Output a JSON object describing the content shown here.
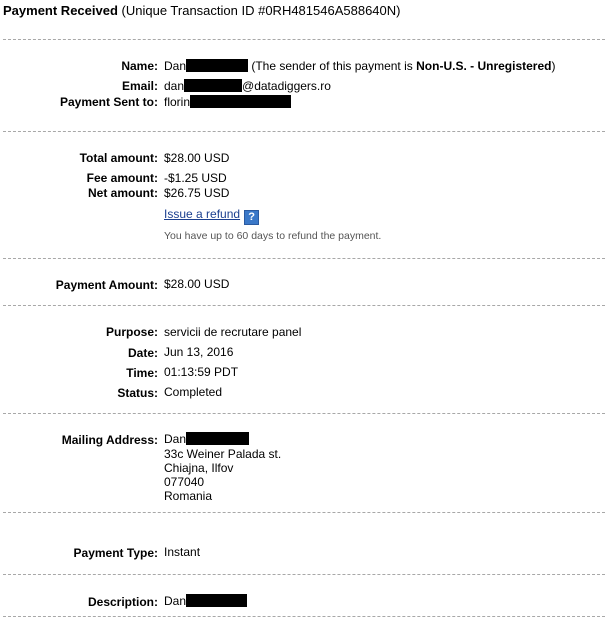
{
  "header": {
    "title_bold": "Payment Received",
    "title_rest": "(Unique Transaction ID #0RH481546A588640N)"
  },
  "sender": {
    "name_label": "Name:",
    "name_value": "Dan",
    "note_prefix": "(The sender of this payment is",
    "note_status": "Non-U.S. - Unregistered",
    "note_suffix": ")",
    "email_label": "Email:",
    "email_prefix": "dan",
    "email_suffix": "@datadiggers.ro",
    "sent_to_label": "Payment Sent to:",
    "sent_to_value": "florin"
  },
  "amounts": {
    "total_label": "Total amount:",
    "total_value": "$28.00 USD",
    "fee_label": "Fee amount:",
    "fee_value": "-$1.25 USD",
    "net_label": "Net amount:",
    "net_value": "$26.75 USD",
    "refund_link": "Issue a refund",
    "help_icon": "?",
    "refund_note": "You have up to 60 days to refund the payment."
  },
  "payment_amount": {
    "label": "Payment Amount:",
    "value": "$28.00 USD"
  },
  "details": {
    "purpose_label": "Purpose:",
    "purpose_value": "servicii de recrutare panel",
    "date_label": "Date:",
    "date_value": "Jun 13, 2016",
    "time_label": "Time:",
    "time_value": "01:13:59 PDT",
    "status_label": "Status:",
    "status_value": "Completed"
  },
  "address": {
    "label": "Mailing Address:",
    "name": "Dan",
    "line1": "33c Weiner Palada st.",
    "line2": "Chiajna, Ilfov",
    "line3": "077040",
    "line4": "Romania"
  },
  "payment_type": {
    "label": "Payment Type:",
    "value": "Instant"
  },
  "description": {
    "label": "Description:",
    "value": "Dan"
  },
  "colors": {
    "link": "#1b3f8f",
    "help_icon_bg": "#3a78c8",
    "separator": "#a8a8a8",
    "note": "#555555"
  }
}
